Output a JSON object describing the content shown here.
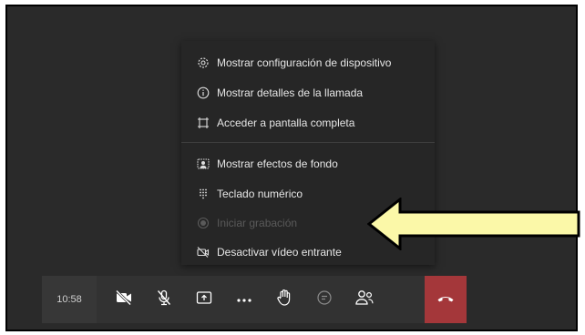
{
  "menu": {
    "items": [
      {
        "label": "Mostrar configuración de dispositivo",
        "icon": "gear-icon",
        "disabled": false
      },
      {
        "label": "Mostrar detalles de la llamada",
        "icon": "info-icon",
        "disabled": false
      },
      {
        "label": "Acceder a pantalla completa",
        "icon": "fullscreen-icon",
        "disabled": false
      },
      {
        "label": "Mostrar efectos de fondo",
        "icon": "background-effects-icon",
        "disabled": false
      },
      {
        "label": "Teclado numérico",
        "icon": "dialpad-icon",
        "disabled": false
      },
      {
        "label": "Iniciar grabación",
        "icon": "record-icon",
        "disabled": true
      },
      {
        "label": "Desactivar vídeo entrante",
        "icon": "video-off-icon",
        "disabled": false
      }
    ]
  },
  "toolbar": {
    "time": "10:58",
    "buttons": [
      "camera-off-icon",
      "mic-off-icon",
      "share-screen-icon",
      "more-icon",
      "raise-hand-icon",
      "chat-icon",
      "participants-icon",
      "hang-up-icon"
    ]
  },
  "colors": {
    "background": "#2a2a2a",
    "menu": "#262626",
    "toolbar": "#323232",
    "hangup": "#a4373a",
    "arrow": "#fbf8a8"
  }
}
